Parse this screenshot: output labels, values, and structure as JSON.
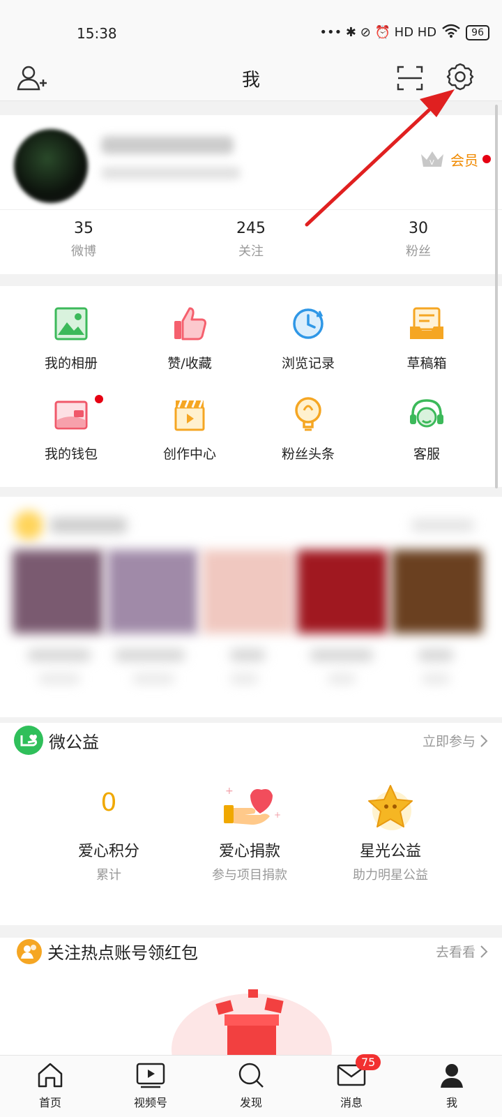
{
  "status": {
    "time": "15:38",
    "battery": "96",
    "indicators": "••• ✱ ⊘ ⏰ HD HD"
  },
  "header": {
    "title": "我"
  },
  "profile": {
    "vip_label": "会员"
  },
  "stats": [
    {
      "number": "35",
      "label": "微博"
    },
    {
      "number": "245",
      "label": "关注"
    },
    {
      "number": "30",
      "label": "粉丝"
    }
  ],
  "grid": [
    {
      "label": "我的相册",
      "icon": "photo-album-icon"
    },
    {
      "label": "赞/收藏",
      "icon": "thumbs-up-icon"
    },
    {
      "label": "浏览记录",
      "icon": "history-clock-icon"
    },
    {
      "label": "草稿箱",
      "icon": "drafts-tray-icon"
    },
    {
      "label": "我的钱包",
      "icon": "wallet-icon"
    },
    {
      "label": "创作中心",
      "icon": "clapperboard-icon"
    },
    {
      "label": "粉丝头条",
      "icon": "lightbulb-icon"
    },
    {
      "label": "客服",
      "icon": "headset-icon"
    }
  ],
  "charity": {
    "title": "微公益",
    "link": "立即参与",
    "items": [
      {
        "value": "0",
        "title": "爱心积分",
        "sub": "累计"
      },
      {
        "title": "爱心捐款",
        "sub": "参与项目捐款"
      },
      {
        "title": "星光公益",
        "sub": "助力明星公益"
      }
    ]
  },
  "redpacket": {
    "title": "关注热点账号领红包",
    "link": "去看看"
  },
  "nav": [
    {
      "label": "首页",
      "icon": "home-icon"
    },
    {
      "label": "视频号",
      "icon": "video-icon"
    },
    {
      "label": "发现",
      "icon": "search-icon"
    },
    {
      "label": "消息",
      "icon": "mail-icon",
      "badge": "75"
    },
    {
      "label": "我",
      "icon": "profile-icon"
    }
  ],
  "colors": {
    "accent": "#f08a00",
    "red": "#e60012",
    "arrow": "#e02020"
  }
}
